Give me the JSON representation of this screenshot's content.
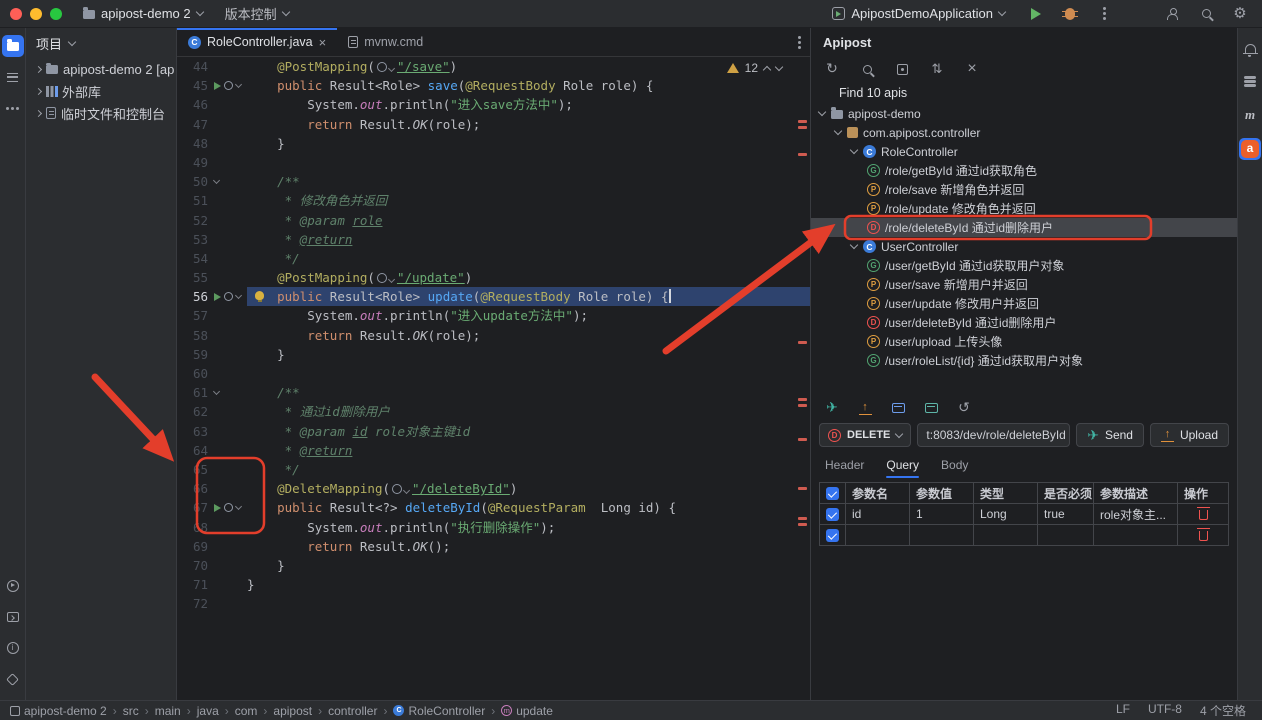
{
  "colors": {
    "accent": "#3574f0",
    "annotation_red": "#e33e2b",
    "get_green": "#52a471",
    "post_orange": "#df9e41",
    "delete_red": "#ef5350",
    "editor_bg": "#1e1f22",
    "panel_bg": "#2b2d30"
  },
  "titlebar": {
    "project": "apipost-demo 2",
    "vcs": "版本控制",
    "run_config": "ApipostDemoApplication",
    "run_icons": [
      "play",
      "debug",
      "more-vert"
    ],
    "corner_icons": [
      "user",
      "search",
      "settings"
    ]
  },
  "left_rail": {
    "top": [
      {
        "tool": "project",
        "active": true
      },
      {
        "tool": "structure"
      },
      {
        "tool": "more"
      }
    ],
    "bottom": [
      {
        "tool": "run"
      },
      {
        "tool": "terminal"
      },
      {
        "tool": "problems"
      },
      {
        "tool": "services"
      }
    ]
  },
  "right_rail": [
    {
      "tool": "notifications"
    },
    {
      "tool": "database"
    },
    {
      "tool": "maven"
    },
    {
      "tool": "apipost",
      "active": true
    }
  ],
  "project_panel": {
    "title": "项目",
    "items": [
      {
        "icon": "project-folder",
        "label": "apipost-demo 2 [ap"
      },
      {
        "icon": "library",
        "label": "外部库"
      },
      {
        "icon": "scratch",
        "label": "临时文件和控制台"
      }
    ]
  },
  "editor": {
    "tabs": [
      {
        "label": "RoleController.java",
        "icon": "class",
        "active": true
      },
      {
        "label": "mvnw.cmd",
        "icon": "text-file",
        "active": false
      }
    ],
    "inspections": "12",
    "stripe": [
      63,
      69,
      96,
      284,
      341,
      347,
      381,
      430,
      460,
      466
    ],
    "code": [
      {
        "n": "44",
        "icons": [],
        "t": [
          [
            "    ",
            "p"
          ],
          [
            "@PostMapping",
            "ann"
          ],
          [
            "(",
            "p"
          ],
          [
            "",
            "apiicon"
          ],
          [
            "\"/save\"",
            "stru"
          ],
          [
            ")",
            "p"
          ]
        ]
      },
      {
        "n": "45",
        "icons": [
          "run",
          "api",
          "fold"
        ],
        "t": [
          [
            "    ",
            "p"
          ],
          [
            "public ",
            "kw"
          ],
          [
            "Result<Role> ",
            "p"
          ],
          [
            "save",
            "mth"
          ],
          [
            "(",
            "p"
          ],
          [
            "@RequestBody",
            "ann"
          ],
          [
            " Role role) {",
            "p"
          ]
        ]
      },
      {
        "n": "46",
        "t": [
          [
            "        ",
            "p"
          ],
          [
            "System.",
            "p"
          ],
          [
            "out",
            "fld"
          ],
          [
            ".println(",
            "p"
          ],
          [
            "\"进入save方法中\"",
            "str"
          ],
          [
            ");",
            "p"
          ]
        ]
      },
      {
        "n": "47",
        "t": [
          [
            "        ",
            "p"
          ],
          [
            "return ",
            "kw"
          ],
          [
            "Result.",
            "p"
          ],
          [
            "OK",
            "stm"
          ],
          [
            "(role);",
            "p"
          ]
        ]
      },
      {
        "n": "48",
        "t": [
          [
            "    }",
            "p"
          ]
        ]
      },
      {
        "n": "49",
        "t": []
      },
      {
        "n": "50",
        "icons": [
          "fold"
        ],
        "t": [
          [
            "    ",
            "p"
          ],
          [
            "/**",
            "cmt"
          ]
        ]
      },
      {
        "n": "51",
        "t": [
          [
            "     ",
            "p"
          ],
          [
            "* 修改角色并返回",
            "cmt"
          ]
        ]
      },
      {
        "n": "52",
        "t": [
          [
            "     ",
            "p"
          ],
          [
            "* ",
            "cmt"
          ],
          [
            "@param ",
            "cmt"
          ],
          [
            "role",
            "cmtu"
          ]
        ]
      },
      {
        "n": "53",
        "t": [
          [
            "     ",
            "p"
          ],
          [
            "* ",
            "cmt"
          ],
          [
            "@return",
            "cmtu"
          ]
        ]
      },
      {
        "n": "54",
        "t": [
          [
            "     ",
            "p"
          ],
          [
            "*/",
            "cmt"
          ]
        ]
      },
      {
        "n": "55",
        "t": [
          [
            "    ",
            "p"
          ],
          [
            "@PostMapping",
            "ann"
          ],
          [
            "(",
            "p"
          ],
          [
            "",
            "apiicon"
          ],
          [
            "\"/update\"",
            "stru"
          ],
          [
            ")",
            "p"
          ]
        ]
      },
      {
        "n": "56",
        "icons": [
          "run",
          "api",
          "fold"
        ],
        "sel": true,
        "bulb": true,
        "caret": true,
        "t": [
          [
            "    ",
            "p"
          ],
          [
            "public ",
            "kw"
          ],
          [
            "Result<Role> ",
            "p"
          ],
          [
            "update",
            "mth"
          ],
          [
            "(",
            "p"
          ],
          [
            "@RequestBody",
            "ann"
          ],
          [
            " Role role) {",
            "p"
          ]
        ]
      },
      {
        "n": "57",
        "t": [
          [
            "        ",
            "p"
          ],
          [
            "System.",
            "p"
          ],
          [
            "out",
            "fld"
          ],
          [
            ".println(",
            "p"
          ],
          [
            "\"进入update方法中\"",
            "str"
          ],
          [
            ");",
            "p"
          ]
        ]
      },
      {
        "n": "58",
        "t": [
          [
            "        ",
            "p"
          ],
          [
            "return ",
            "kw"
          ],
          [
            "Result.",
            "p"
          ],
          [
            "OK",
            "stm"
          ],
          [
            "(role);",
            "p"
          ]
        ]
      },
      {
        "n": "59",
        "t": [
          [
            "    }",
            "p"
          ]
        ]
      },
      {
        "n": "60",
        "t": []
      },
      {
        "n": "61",
        "icons": [
          "fold"
        ],
        "t": [
          [
            "    ",
            "p"
          ],
          [
            "/**",
            "cmt"
          ]
        ]
      },
      {
        "n": "62",
        "t": [
          [
            "     ",
            "p"
          ],
          [
            "* 通过id删除用户",
            "cmt"
          ]
        ]
      },
      {
        "n": "63",
        "t": [
          [
            "     ",
            "p"
          ],
          [
            "* ",
            "cmt"
          ],
          [
            "@param ",
            "cmt"
          ],
          [
            "id",
            "cmtu"
          ],
          [
            " role对象主键id",
            "cmt"
          ]
        ]
      },
      {
        "n": "64",
        "t": [
          [
            "     ",
            "p"
          ],
          [
            "* ",
            "cmt"
          ],
          [
            "@return",
            "cmtu"
          ]
        ]
      },
      {
        "n": "65",
        "t": [
          [
            "     ",
            "p"
          ],
          [
            "*/",
            "cmt"
          ]
        ]
      },
      {
        "n": "66",
        "t": [
          [
            "    ",
            "p"
          ],
          [
            "@DeleteMapping",
            "ann"
          ],
          [
            "(",
            "p"
          ],
          [
            "",
            "apiicon"
          ],
          [
            "\"/deleteById\"",
            "stru"
          ],
          [
            ")",
            "p"
          ]
        ]
      },
      {
        "n": "67",
        "icons": [
          "run",
          "api",
          "fold"
        ],
        "t": [
          [
            "    ",
            "p"
          ],
          [
            "public ",
            "kw"
          ],
          [
            "Result<?> ",
            "p"
          ],
          [
            "deleteById",
            "mth"
          ],
          [
            "(",
            "p"
          ],
          [
            "@RequestParam",
            "ann"
          ],
          [
            "  Long id) {",
            "p"
          ]
        ]
      },
      {
        "n": "68",
        "t": [
          [
            "        ",
            "p"
          ],
          [
            "System.",
            "p"
          ],
          [
            "out",
            "fld"
          ],
          [
            ".println(",
            "p"
          ],
          [
            "\"执行删除操作\"",
            "str"
          ],
          [
            ");",
            "p"
          ]
        ]
      },
      {
        "n": "69",
        "t": [
          [
            "        ",
            "p"
          ],
          [
            "return ",
            "kw"
          ],
          [
            "Result.",
            "p"
          ],
          [
            "OK",
            "stm"
          ],
          [
            "();",
            "p"
          ]
        ]
      },
      {
        "n": "70",
        "t": [
          [
            "    }",
            "p"
          ]
        ]
      },
      {
        "n": "71",
        "t": [
          [
            "}",
            "p"
          ]
        ]
      },
      {
        "n": "72",
        "t": []
      }
    ]
  },
  "apipost": {
    "title": "Apipost",
    "find_text": "Find 10 apis",
    "toolbar": [
      "refresh",
      "search-small",
      "locate",
      "sync",
      "close"
    ],
    "tree": [
      {
        "i": 0,
        "t": "project",
        "c": true,
        "l": "apipost-demo"
      },
      {
        "i": 1,
        "t": "package",
        "c": true,
        "l": "com.apipost.controller"
      },
      {
        "i": 2,
        "t": "class",
        "c": true,
        "l": "RoleController"
      },
      {
        "i": 3,
        "t": "get",
        "l": "/role/getById 通过id获取角色"
      },
      {
        "i": 3,
        "t": "post",
        "l": "/role/save 新增角色并返回"
      },
      {
        "i": 3,
        "t": "post",
        "l": "/role/update 修改角色并返回"
      },
      {
        "i": 3,
        "t": "delete",
        "l": "/role/deleteById 通过id删除用户",
        "sel": true
      },
      {
        "i": 2,
        "t": "class",
        "c": true,
        "l": "UserController"
      },
      {
        "i": 3,
        "t": "get",
        "l": "/user/getById 通过id获取用户对象"
      },
      {
        "i": 3,
        "t": "post",
        "l": "/user/save 新增用户并返回"
      },
      {
        "i": 3,
        "t": "post",
        "l": "/user/update 修改用户并返回"
      },
      {
        "i": 3,
        "t": "delete",
        "l": "/user/deleteById 通过id删除用户"
      },
      {
        "i": 3,
        "t": "post",
        "l": "/user/upload 上传头像"
      },
      {
        "i": 3,
        "t": "get",
        "l": "/user/roleList/{id} 通过id获取用户对象"
      }
    ],
    "actions": [
      "plane",
      "upload-tray",
      "card-blue",
      "card-teal",
      "history"
    ],
    "request": {
      "method": "DELETE",
      "url": "t:8083/dev/role/deleteById",
      "send_label": "Send",
      "upload_label": "Upload"
    },
    "tabs": [
      "Header",
      "Query",
      "Body"
    ],
    "active_tab": 1,
    "table": {
      "headers": [
        "参数名",
        "参数值",
        "类型",
        "是否必须",
        "参数描述",
        "操作"
      ],
      "rows": [
        {
          "checked": true,
          "cells": [
            "id",
            "1",
            "Long",
            "true",
            "role对象主..."
          ]
        },
        {
          "checked": true,
          "cells": [
            "",
            "",
            "",
            "",
            ""
          ]
        }
      ]
    }
  },
  "statusbar": {
    "breadcrumbs": [
      {
        "icon": "project",
        "l": "apipost-demo 2"
      },
      {
        "l": "src"
      },
      {
        "l": "main"
      },
      {
        "l": "java"
      },
      {
        "l": "com"
      },
      {
        "l": "apipost"
      },
      {
        "l": "controller"
      },
      {
        "icon": "class",
        "l": "RoleController"
      },
      {
        "icon": "method",
        "l": "update"
      }
    ],
    "right": [
      "LF",
      "UTF-8",
      "4 个空格"
    ]
  }
}
